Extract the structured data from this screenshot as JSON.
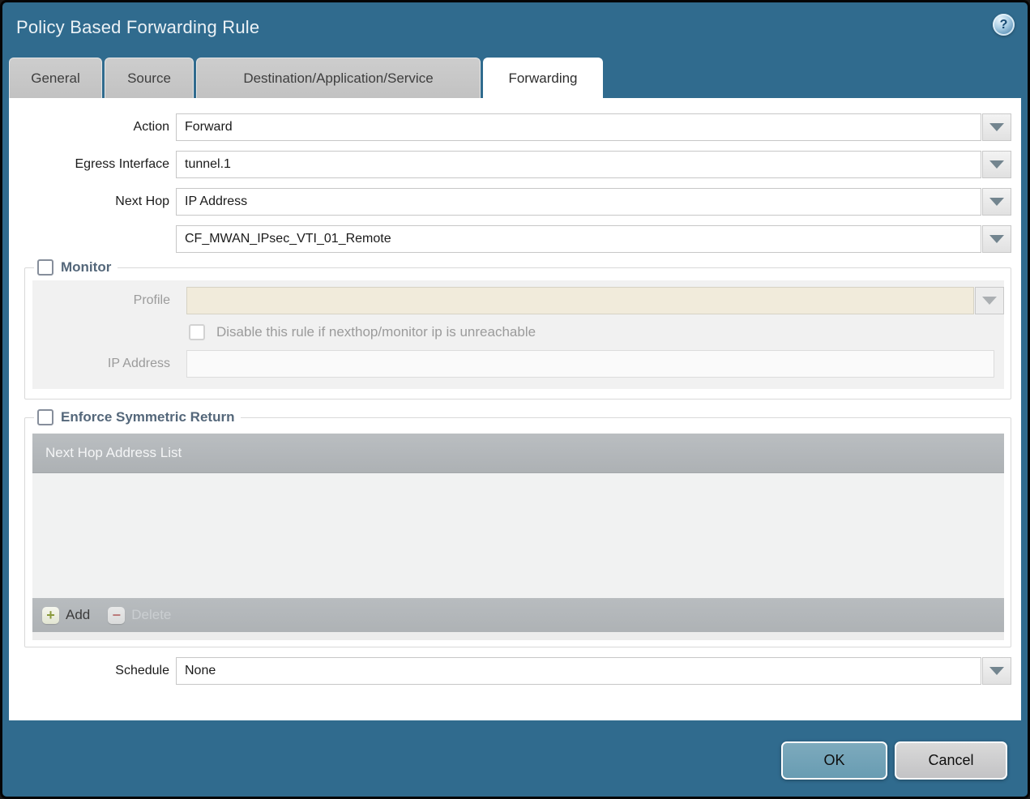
{
  "window": {
    "title": "Policy Based Forwarding Rule"
  },
  "help": {
    "glyph": "?"
  },
  "tabs": [
    {
      "label": "General",
      "active": false
    },
    {
      "label": "Source",
      "active": false
    },
    {
      "label": "Destination/Application/Service",
      "active": false
    },
    {
      "label": "Forwarding",
      "active": true
    }
  ],
  "form": {
    "action": {
      "label": "Action",
      "value": "Forward"
    },
    "egress_interface": {
      "label": "Egress Interface",
      "value": "tunnel.1"
    },
    "next_hop": {
      "label": "Next Hop",
      "value": "IP Address"
    },
    "next_hop_address": {
      "value": "CF_MWAN_IPsec_VTI_01_Remote"
    },
    "schedule": {
      "label": "Schedule",
      "value": "None"
    }
  },
  "monitor": {
    "legend": "Monitor",
    "checked": false,
    "profile": {
      "label": "Profile",
      "value": ""
    },
    "disable_rule": {
      "label": "Disable this rule if nexthop/monitor ip is unreachable",
      "checked": false
    },
    "ip_address": {
      "label": "IP Address",
      "value": ""
    }
  },
  "enforce_symmetric_return": {
    "legend": "Enforce Symmetric Return",
    "checked": false,
    "table": {
      "header": "Next Hop Address List",
      "rows": []
    },
    "toolbar": {
      "add_label": "Add",
      "delete_label": "Delete"
    }
  },
  "buttons": {
    "ok": "OK",
    "cancel": "Cancel"
  },
  "icons": {
    "help": "help-icon",
    "dropdown": "chevron-down-icon",
    "add": "add-icon",
    "delete": "delete-icon"
  },
  "colors": {
    "titlebar": "#306b8e",
    "active_tab": "#ffffff",
    "inactive_tab": "#c6c6c6",
    "disabled_field": "#f1ebdb",
    "grid_header": "#b3b7ba",
    "ok_button": "#74a3b9",
    "cancel_button": "#cccccc",
    "legend_text": "#54677a"
  }
}
